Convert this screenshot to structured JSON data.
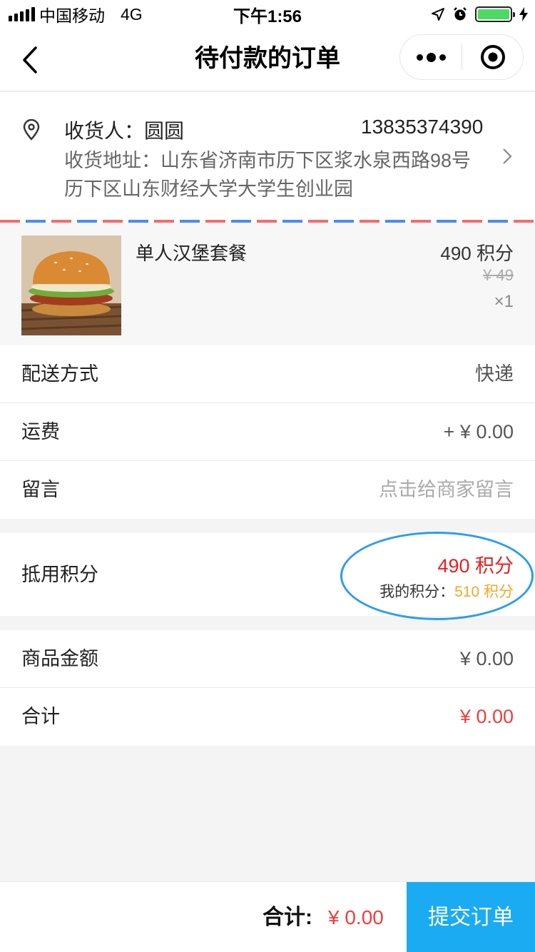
{
  "status_bar": {
    "carrier": "中国移动",
    "network": "4G",
    "time": "下午1:56"
  },
  "nav": {
    "title": "待付款的订单"
  },
  "address": {
    "name": "收货人：圆圆",
    "phone": "13835374390",
    "line1": "收货地址：山东省济南市历下区浆水泉西路98号",
    "line2": "历下区山东财经大学大学生创业园"
  },
  "product": {
    "name": "单人汉堡套餐",
    "points": "490 积分",
    "original_price": "¥ 49",
    "quantity": "×1"
  },
  "info_rows": [
    {
      "label": "配送方式",
      "value": "快递"
    },
    {
      "label": "运费",
      "value": "+ ¥ 0.00"
    },
    {
      "label": "留言",
      "value": "点击给商家留言"
    }
  ],
  "points": {
    "label": "抵用积分",
    "use": "490 积分",
    "mine_label": "我的积分：",
    "mine_value": "510 积分"
  },
  "amount_rows": [
    {
      "label": "商品金额",
      "value": "¥ 0.00"
    },
    {
      "label": "合计",
      "value": "¥ 0.00"
    }
  ],
  "footer": {
    "total_label": "合计:",
    "total_value": "¥ 0.00",
    "submit": "提交订单"
  },
  "colors": {
    "accent": "#1aabf2",
    "price_red": "#f23c3c",
    "points_orange": "#f5a623",
    "highlight_ellipse": "#2c9cf0"
  }
}
